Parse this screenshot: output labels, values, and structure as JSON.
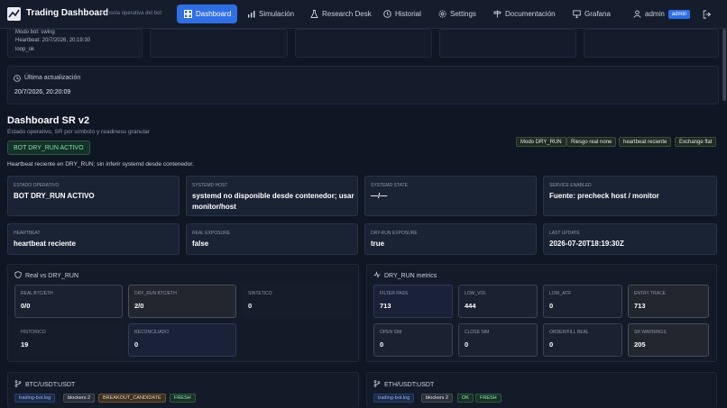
{
  "nav": {
    "title": "Trading Dashboard",
    "subtitle": "Consola operativa del bot",
    "items": [
      {
        "label": "Dashboard",
        "icon": "dashboard-icon"
      },
      {
        "label": "Simulación",
        "icon": "chart-icon"
      },
      {
        "label": "Research Desk",
        "icon": "flask-icon"
      },
      {
        "label": "Historial",
        "icon": "clock-icon"
      },
      {
        "label": "Settings",
        "icon": "gear-icon"
      },
      {
        "label": "Documentación",
        "icon": "signpost-icon"
      },
      {
        "label": "Grafana",
        "icon": "monitor-icon"
      }
    ],
    "user": "admin",
    "user_role": "admin"
  },
  "top_status": {
    "mode": "Modo bot: swing",
    "heartbeat": "Heartbeat: 20/7/2026, 20:19:30",
    "loop": "loop_ok"
  },
  "last_update": {
    "label": "Última actualización",
    "value": "20/7/2026, 20:20:09"
  },
  "header": {
    "title": "Dashboard SR v2",
    "subtitle": "Estado operativo, SR por símbolo y readiness granular",
    "bot_status": "BOT DRY_RUN ACTIVO",
    "tags": [
      "Modo DRY_RUN",
      "Riesgo real none",
      "heartbeat reciente",
      "Exchange flat"
    ],
    "note": "Heartbeat reciente en DRY_RUN; sin inferir systemd desde contenedor."
  },
  "status_cards": [
    {
      "label": "ESTADO OPERATIVO",
      "value": "BOT DRY_RUN ACTIVO"
    },
    {
      "label": "SYSTEMD HOST",
      "value": "systemd no disponible desde contenedor; usar monitor/host"
    },
    {
      "label": "SYSTEMD STATE",
      "value": "—/—"
    },
    {
      "label": "SERVICE ENABLED",
      "value": "Fuente: precheck host / monitor"
    },
    {
      "label": "HEARTBEAT",
      "value": "heartbeat reciente"
    },
    {
      "label": "REAL EXPOSURE",
      "value": "false"
    },
    {
      "label": "DRY-RUN EXPOSURE",
      "value": "true"
    },
    {
      "label": "LAST UPDATE",
      "value": "2026-07-20T18:19:30Z"
    }
  ],
  "real_vs_dry": {
    "title": "Real vs DRY_RUN",
    "cards": [
      {
        "label": "REAL BTC/ETH",
        "value": "0/0"
      },
      {
        "label": "DRY_RUN BTC/ETH",
        "value": "2/0"
      },
      {
        "label": "SINTETICO",
        "value": "0"
      },
      {
        "label": "HISTORICO",
        "value": "19"
      },
      {
        "label": "RECONCILIADO",
        "value": "0"
      }
    ]
  },
  "dry_metrics": {
    "title": "DRY_RUN metrics",
    "cards": [
      {
        "label": "FILTER PASS",
        "value": "713"
      },
      {
        "label": "LOW_VOL",
        "value": "444"
      },
      {
        "label": "LOW_ATR",
        "value": "0"
      },
      {
        "label": "ENTRY TRACE",
        "value": "713"
      },
      {
        "label": "OPEN SIM",
        "value": "0"
      },
      {
        "label": "CLOSE SIM",
        "value": "0"
      },
      {
        "label": "ORDER/FILL REAL",
        "value": "0"
      },
      {
        "label": "SR WARNINGS",
        "value": "205"
      }
    ]
  },
  "symbols": [
    {
      "title": "BTC/USDT:USDT",
      "chips": [
        "trading-bot.log",
        "blockers 2",
        "BREAKOUT_CANDIDATE",
        "FRESH"
      ]
    },
    {
      "title": "ETH/USDT:USDT",
      "chips": [
        "trading-bot.log",
        "blockers 2",
        "OK",
        "FRESH"
      ]
    }
  ]
}
